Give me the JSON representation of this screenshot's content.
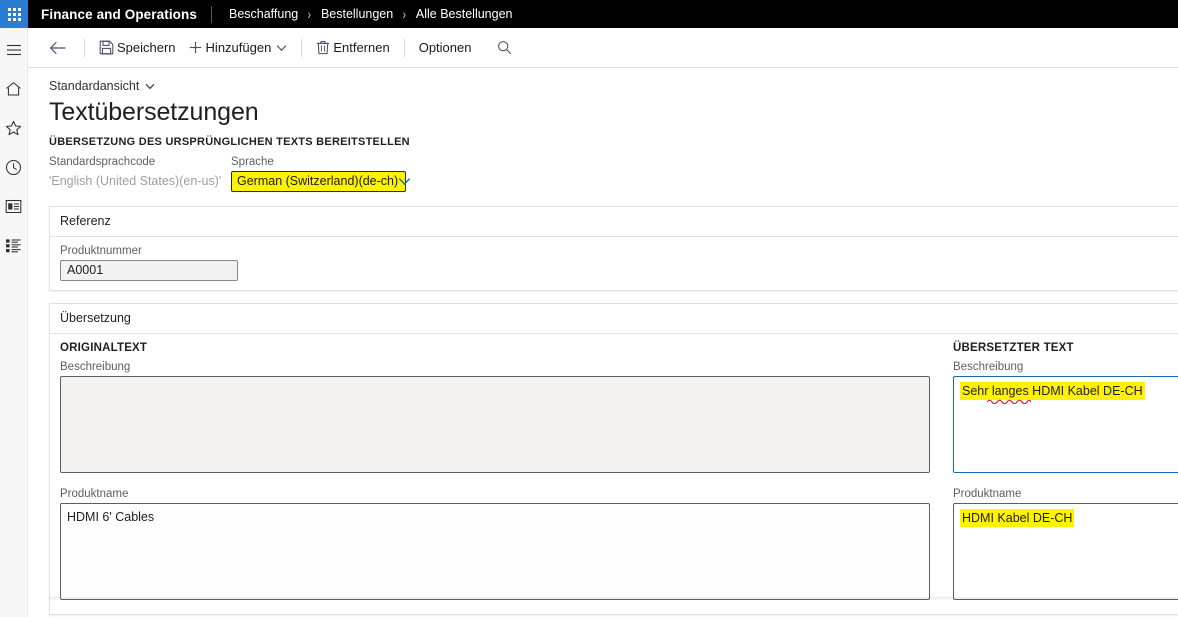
{
  "topbar": {
    "app_launcher_icon": "waffle-grid-icon",
    "brand": "Finance and Operations",
    "breadcrumb": [
      "Beschaffung",
      "Bestellungen",
      "Alle Bestellungen"
    ],
    "separator": "›"
  },
  "rail": {
    "items": [
      {
        "icon": "hamburger-menu-icon",
        "name": "navigation-menu"
      },
      {
        "icon": "home-icon",
        "name": "home"
      },
      {
        "icon": "star-icon",
        "name": "favorites"
      },
      {
        "icon": "clock-icon",
        "name": "recent"
      },
      {
        "icon": "workspace-icon",
        "name": "workspaces"
      },
      {
        "icon": "list-icon",
        "name": "modules"
      }
    ]
  },
  "toolbar": {
    "back_icon": "back-arrow-icon",
    "save_label": "Speichern",
    "save_icon": "save-floppy-icon",
    "add_label": "Hinzufügen",
    "add_icon": "plus-icon",
    "add_chevron_icon": "chevron-down-icon",
    "remove_label": "Entfernen",
    "remove_icon": "trash-icon",
    "options_label": "Optionen",
    "search_icon": "search-icon"
  },
  "page": {
    "view_selector": "Standardansicht",
    "view_chevron_icon": "chevron-down-icon",
    "title": "Textübersetzungen",
    "caption": "ÜBERSETZUNG DES URSPRÜNGLICHEN TEXTS BEREITSTELLEN"
  },
  "header_fields": {
    "default_language_label": "Standardsprachcode",
    "default_language_value": "'English (United States)(en-us)'",
    "language_label": "Sprache",
    "language_value": "German (Switzerland)(de-ch)",
    "language_chevron_icon": "chevron-down-icon"
  },
  "reference_section": {
    "header": "Referenz",
    "product_number_label": "Produktnummer",
    "product_number_value": "A0001"
  },
  "translation_section": {
    "header": "Übersetzung",
    "original_heading": "ORIGINALTEXT",
    "translated_heading": "ÜBERSETZTER TEXT",
    "description_label": "Beschreibung",
    "product_name_label": "Produktname",
    "original_description_value": "",
    "original_product_name_value": "HDMI 6' Cables",
    "translated_description_value": "Sehr langes HDMI Kabel DE-CH",
    "translated_product_name_value": "HDMI Kabel DE-CH"
  },
  "colors": {
    "topbar_bg": "#000000",
    "accent_blue": "#2b7cd3",
    "highlight_yellow": "#fff200",
    "focus_border_blue": "#1a6bb0",
    "spellcheck_red": "#e81123"
  }
}
